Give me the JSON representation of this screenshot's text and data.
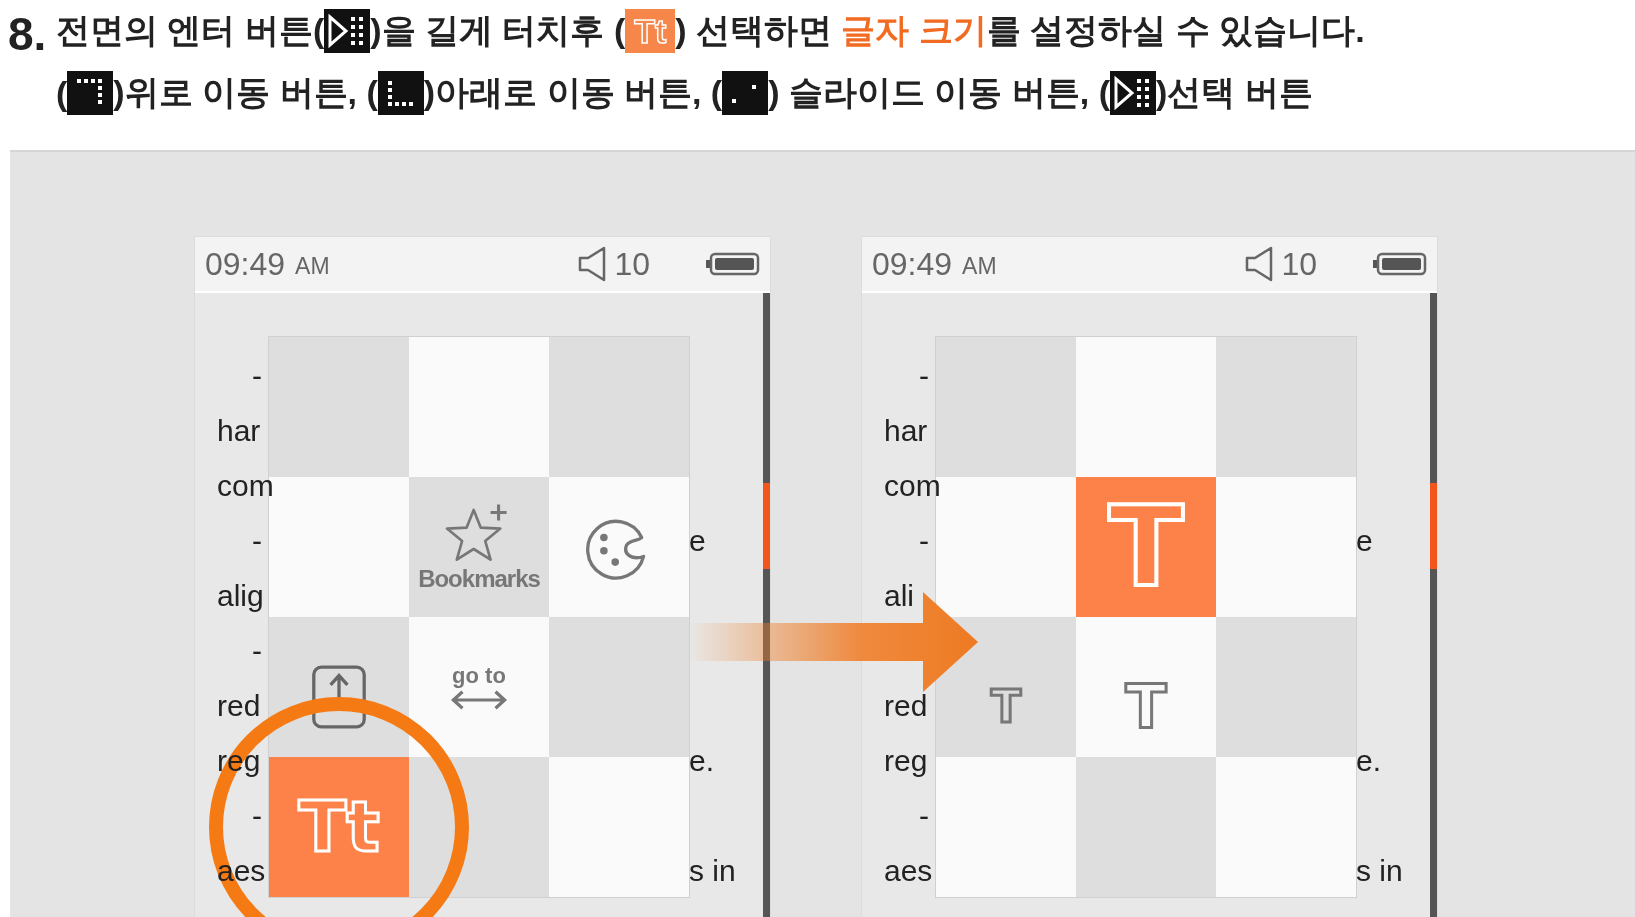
{
  "instruction": {
    "step": "8.",
    "lines": [
      [
        {
          "kind": "text",
          "text": "전면의 엔터 버튼("
        },
        {
          "kind": "enter-key"
        },
        {
          "kind": "text",
          "text": ")을 길게 터치후 ("
        },
        {
          "kind": "font-key",
          "text": "Tt"
        },
        {
          "kind": "text",
          "text": ") 선택하면 "
        },
        {
          "kind": "highlight",
          "text": "글자 크기"
        },
        {
          "kind": "text",
          "text": "를 설정하실 수 있습니다."
        }
      ],
      [
        {
          "kind": "text",
          "text": "("
        },
        {
          "kind": "up-key"
        },
        {
          "kind": "text",
          "text": ")위로 이동 버튼, ("
        },
        {
          "kind": "down-key"
        },
        {
          "kind": "text",
          "text": ")아래로 이동 버튼, ("
        },
        {
          "kind": "slide-key"
        },
        {
          "kind": "text",
          "text": ") 슬라이드 이동 버튼, ("
        },
        {
          "kind": "enter-key"
        },
        {
          "kind": "text",
          "text": ")선택 버튼"
        }
      ]
    ]
  },
  "screens": [
    {
      "status_bar": {
        "time": "09:49",
        "meridiem": "AM",
        "volume": "10"
      },
      "highlight_ring": true,
      "lines": [
        {
          "kind": "bullet",
          "text": "-"
        },
        {
          "kind": "cont",
          "text": "har"
        },
        {
          "kind": "cont",
          "text": "com"
        },
        {
          "kind": "bullet",
          "text": "-",
          "tail": "e"
        },
        {
          "kind": "cont",
          "text": "alig"
        },
        {
          "kind": "bullet",
          "text": "-"
        },
        {
          "kind": "cont",
          "text": "red"
        },
        {
          "kind": "cont",
          "text": "reg",
          "tail": "e."
        },
        {
          "kind": "bullet",
          "text": "-"
        },
        {
          "kind": "cont",
          "text": "aes",
          "tail": "s in"
        }
      ],
      "menu": [
        {
          "kind": "blank",
          "selected": false
        },
        {
          "kind": "blank",
          "selected": false
        },
        {
          "kind": "blank",
          "selected": false
        },
        {
          "kind": "blank",
          "selected": false
        },
        {
          "kind": "bookmarks",
          "label": "Bookmarks",
          "selected": false
        },
        {
          "kind": "palette",
          "selected": false
        },
        {
          "kind": "page-up",
          "selected": false
        },
        {
          "kind": "goto",
          "label": "go to",
          "selected": false
        },
        {
          "kind": "blank",
          "selected": false
        },
        {
          "kind": "font-size",
          "label": "Tt",
          "selected": true
        },
        {
          "kind": "blank",
          "selected": false
        },
        {
          "kind": "blank",
          "selected": false
        }
      ]
    },
    {
      "status_bar": {
        "time": "09:49",
        "meridiem": "AM",
        "volume": "10"
      },
      "highlight_ring": false,
      "lines": [
        {
          "kind": "bullet",
          "text": "-"
        },
        {
          "kind": "cont",
          "text": "har"
        },
        {
          "kind": "cont",
          "text": "com"
        },
        {
          "kind": "bullet",
          "text": "-",
          "tail": "e"
        },
        {
          "kind": "cont",
          "text": "ali"
        },
        {
          "kind": "covered"
        },
        {
          "kind": "cont",
          "text": "red"
        },
        {
          "kind": "cont",
          "text": "reg",
          "tail": "e."
        },
        {
          "kind": "bullet",
          "text": "-"
        },
        {
          "kind": "cont",
          "text": "aes",
          "tail": "s in"
        }
      ],
      "menu": [
        {
          "kind": "blank",
          "selected": false
        },
        {
          "kind": "blank",
          "selected": false
        },
        {
          "kind": "blank",
          "selected": false
        },
        {
          "kind": "blank",
          "selected": false
        },
        {
          "kind": "large-t",
          "label": "T",
          "selected": true
        },
        {
          "kind": "blank",
          "selected": false
        },
        {
          "kind": "small-t",
          "label": "T",
          "selected": false
        },
        {
          "kind": "medium-t",
          "label": "T",
          "selected": false
        },
        {
          "kind": "blank",
          "selected": false
        },
        {
          "kind": "blank",
          "selected": false
        },
        {
          "kind": "blank",
          "selected": false
        },
        {
          "kind": "blank",
          "selected": false
        }
      ]
    }
  ]
}
